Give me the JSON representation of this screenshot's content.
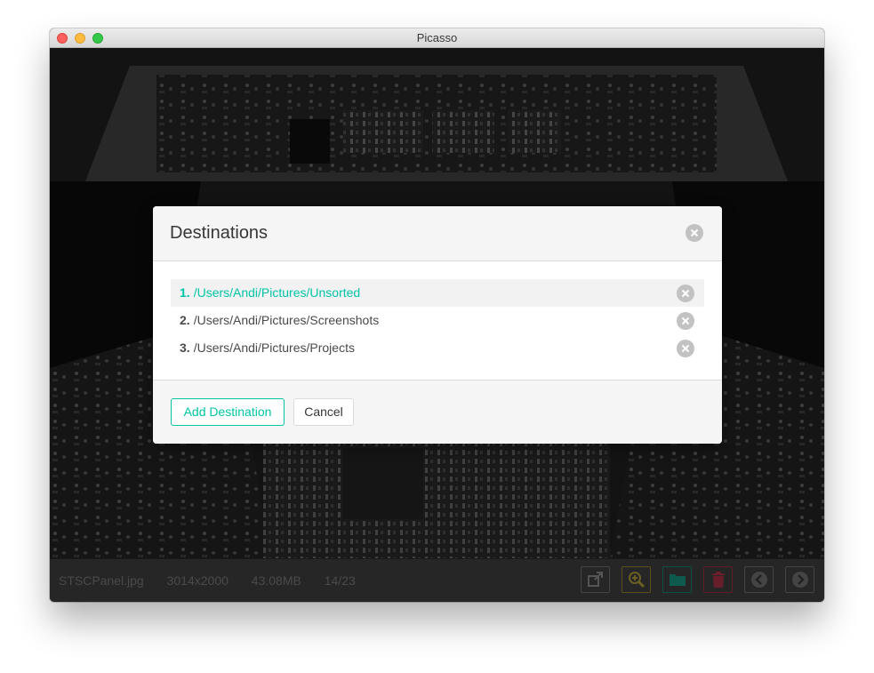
{
  "window": {
    "title": "Picasso"
  },
  "status": {
    "filename": "STSCPanel.jpg",
    "dimensions": "3014x2000",
    "filesize": "43.08MB",
    "position": "14/23"
  },
  "toolbar": {
    "open_external_icon": "open-external-icon",
    "zoom_icon": "zoom-icon",
    "folder_icon": "folder-icon",
    "trash_icon": "trash-icon",
    "prev_icon": "chevron-left-icon",
    "next_icon": "chevron-right-icon",
    "colors": {
      "zoom": "#ffdd57",
      "folder": "#00c4a7",
      "trash": "#ff3860",
      "neutral": "#7a7a7a"
    }
  },
  "modal": {
    "title": "Destinations",
    "destinations": [
      {
        "num": "1.",
        "path": "/Users/Andi/Pictures/Unsorted",
        "active": true
      },
      {
        "num": "2.",
        "path": "/Users/Andi/Pictures/Screenshots",
        "active": false
      },
      {
        "num": "3.",
        "path": "/Users/Andi/Pictures/Projects",
        "active": false
      }
    ],
    "add_label": "Add Destination",
    "cancel_label": "Cancel",
    "accent_color": "#00c4a7"
  }
}
